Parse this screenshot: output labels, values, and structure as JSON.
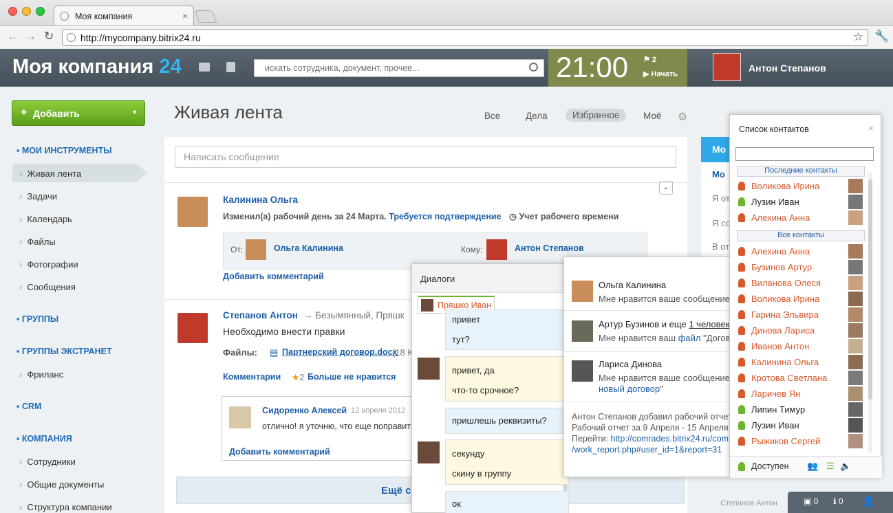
{
  "browser": {
    "tab_title": "Моя компания",
    "url": "http://mycompany.bitrix24.ru"
  },
  "header": {
    "logo": "Моя компания",
    "logo_num": "24",
    "search_placeholder": "искать сотрудника, документ, прочее...",
    "time": "21:00",
    "flags": "2",
    "start": "Начать",
    "user": "Антон Степанов"
  },
  "sidebar": {
    "add": "Добавить",
    "sections": {
      "tools": "МОИ ИНСТРУМЕНТЫ",
      "groups": "ГРУППЫ",
      "extranet": "ГРУППЫ ЭКСТРАНЕТ",
      "crm": "CRM",
      "company": "КОМПАНИЯ"
    },
    "items": [
      "Живая лента",
      "Задачи",
      "Календарь",
      "Файлы",
      "Фотографии",
      "Сообщения"
    ],
    "ext_items": [
      "Фриланс"
    ],
    "company_items": [
      "Сотрудники",
      "Общие документы",
      "Структура компании"
    ]
  },
  "feed": {
    "title": "Живая лента",
    "tabs": [
      "Все",
      "Дела",
      "Избранное",
      "Моё"
    ],
    "placeholder": "Написать сообщение",
    "post1": {
      "author": "Калинина Ольга",
      "text": "Изменил(а) рабочий день за 24 Марта.",
      "confirm": "Требуется подтверждение",
      "type": "Учет рабочего времени",
      "from_label": "От:",
      "from": "Ольга Калинина",
      "to_label": "Кому:",
      "to": "Антон Степанов",
      "add_comment": "Добавить комментарий"
    },
    "post2": {
      "author": "Степанов Антон",
      "arrow_text": "→ Безымянный, Пряшк",
      "text": "Необходимо внести правки",
      "files_label": "Файлы:",
      "file": "Партнерский договор.docx",
      "file_size": "(18 К",
      "comments": "Комментарии",
      "star_count": "2",
      "unlike": "Больше не нравится",
      "comment": {
        "author": "Сидоренко Алексей",
        "date": "12 апреля 2012",
        "text": "отлично! я уточню, что еще поправить"
      },
      "add_comment": "Добавить комментарий"
    },
    "more": "Ещё с"
  },
  "dialogs": {
    "title": "Диалоги",
    "tab": "Пряшко Иван",
    "messages": [
      "привет",
      "тут?",
      "привет, да",
      "что-то срочное?",
      "пришлешь реквизиты?",
      "секунду",
      "скину в группу",
      "ок"
    ]
  },
  "notifications": [
    {
      "name": "Ольга Калинина",
      "text": "Мне нравится ваше сообщение"
    },
    {
      "name": "Артур Бузинов и еще",
      "link": "1 человек",
      "text": "Мне нравится ваш",
      "link2": "файл",
      "text2": "\"Догово"
    },
    {
      "name": "Лариса Динова",
      "text": "Мне нравится ваше сообщение",
      "link": "новый договор",
      "text2": "\""
    }
  ],
  "notif_report": {
    "l1": "Антон Степанов добавил рабочий отчет",
    "l2": "Рабочий отчет за 9 Апреля - 15 Апреля",
    "l3": "Перейти:",
    "link1": "http://comrades.bitrix24.ru/com",
    "link2": "/work_report.php#user_id=1&report=31"
  },
  "right_panel": {
    "title": "Мо",
    "items": [
      "Мо",
      "Я от",
      "Я со",
      "В от"
    ]
  },
  "contacts": {
    "title": "Список контактов",
    "recent_label": "Последние контакты",
    "all_label": "Все контакты",
    "status": "Доступен",
    "recent": [
      "Воликова Ирина",
      "Лузин Иван",
      "Алехина Анна"
    ],
    "all": [
      "Алехина Анна",
      "Бузинов Артур",
      "Виланова Олеся",
      "Воликова Ирина",
      "Гарина Эльвира",
      "Динова Лариса",
      "Иванов Антон",
      "Калинина Ольга",
      "Кротова Светлана",
      "Ларичев Ян",
      "Липин Тимур",
      "Лузин Иван",
      "Рыжиков Сергей"
    ],
    "footer_signature": "Степанов Антон"
  },
  "bottombar": {
    "chat": "0",
    "notif": "0"
  },
  "colors": {
    "accent": "#1d5fa8",
    "header": "#525d67",
    "clock": "#7f8b4c",
    "green": "#6cb52d",
    "orange": "#d65a2c"
  }
}
